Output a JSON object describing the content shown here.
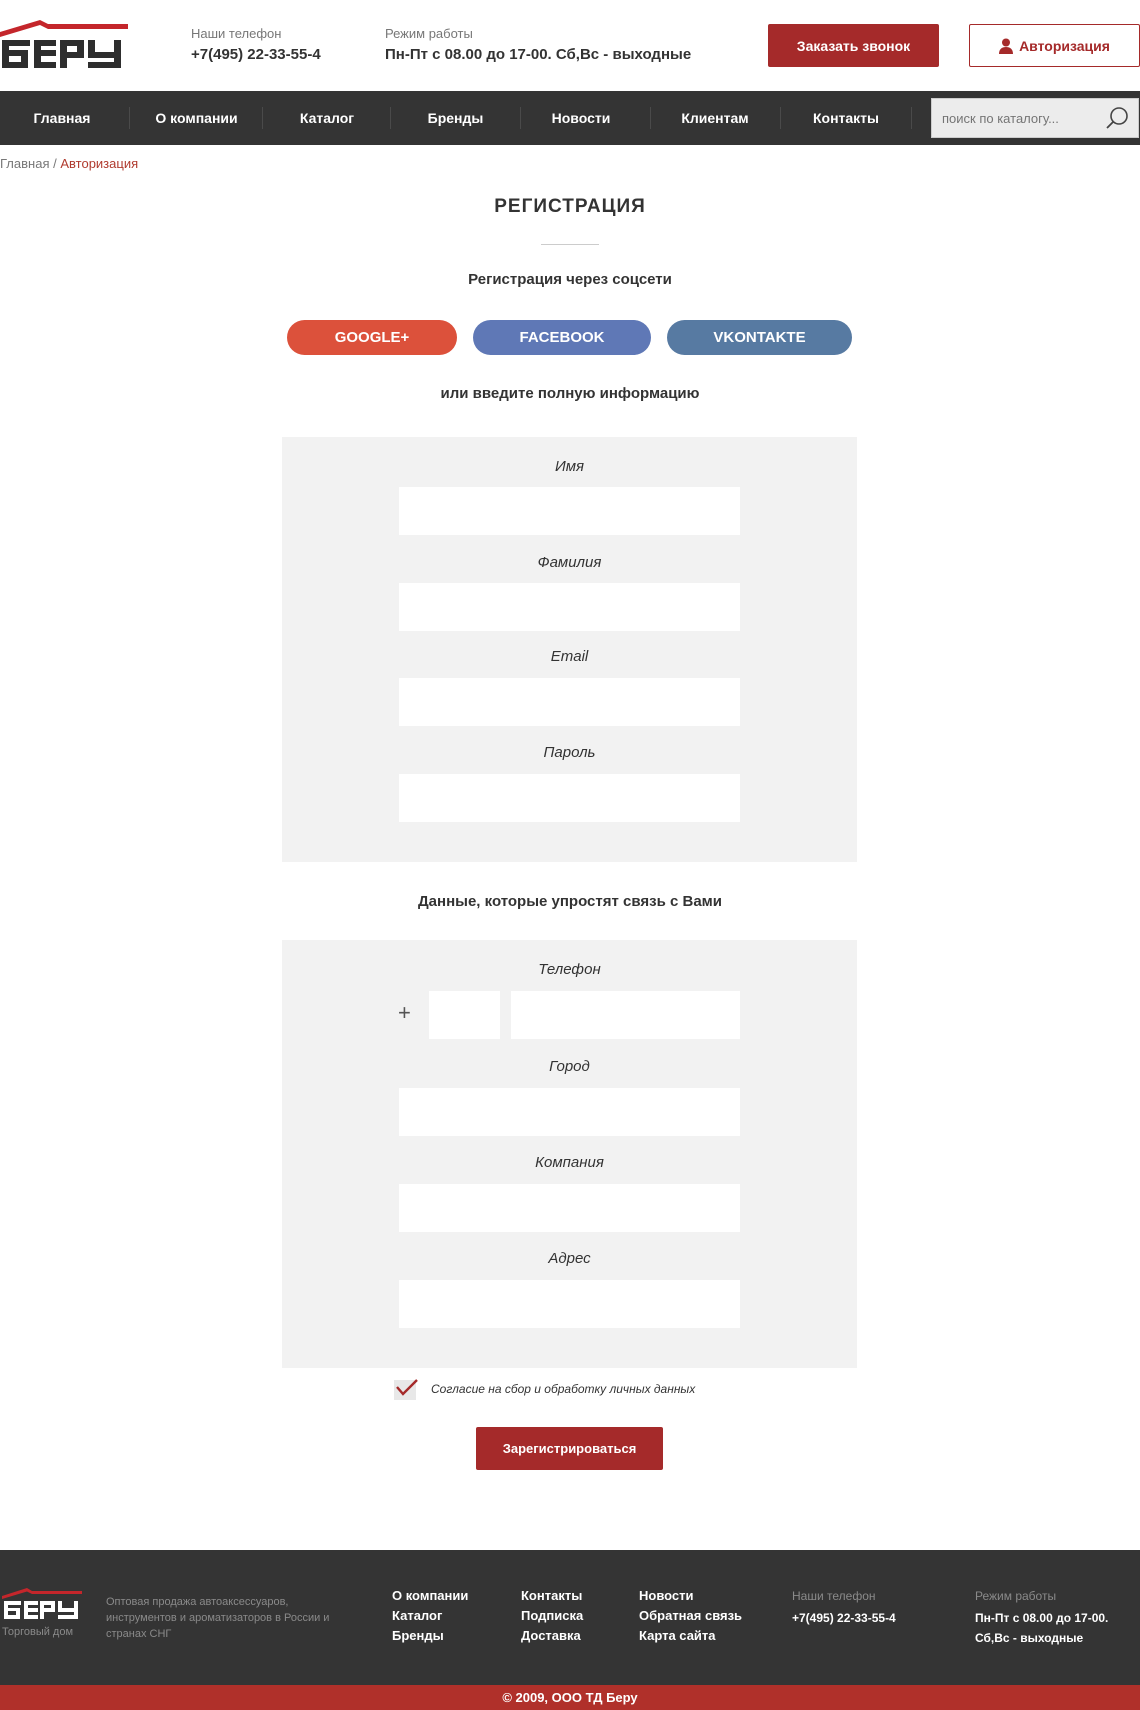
{
  "header": {
    "phone_label": "Наши телефон",
    "phone": "+7(495) 22-33-55-4",
    "hours_label": "Режим работы",
    "hours": "Пн-Пт с 08.00 до 17-00. Сб,Вс - выходные",
    "call_button": "Заказать звонок",
    "auth_button": "Авторизация",
    "logo_text": "БЕРУ"
  },
  "nav": {
    "items": [
      "Главная",
      "О компании",
      "Каталог",
      "Бренды",
      "Новости",
      "Клиентам",
      "Контакты"
    ],
    "search_placeholder": "поиск по каталогу..."
  },
  "breadcrumb": {
    "home": "Главная",
    "separator": "/",
    "current": "Авторизация"
  },
  "page": {
    "title": "РЕГИСТРАЦИЯ",
    "social_title": "Регистрация через соцсети",
    "social": {
      "google": "GOOGLE+",
      "facebook": "FACEBOOK",
      "vkontakte": "VKONTAKTE"
    },
    "or_text": "или введите полную информацию",
    "contact_title": "Данные, которые упростят связь с Вами"
  },
  "form": {
    "name_label": "Имя",
    "surname_label": "Фамилия",
    "email_label": "Email",
    "password_label": "Пароль",
    "phone_label": "Телефон",
    "phone_prefix": "+",
    "city_label": "Город",
    "company_label": "Компания",
    "address_label": "Адрес",
    "consent": "Согласие на сбор и обработку личных данных",
    "consent_checked": true,
    "submit": "Зарегистрироваться"
  },
  "footer": {
    "logo_text": "БЕРУ",
    "logo_sub": "Торговый дом",
    "description": "Оптовая продажа автоаксессуаров, инструментов и ароматизаторов в России и странах СНГ",
    "links_col1": [
      "О компании",
      "Каталог",
      "Бренды"
    ],
    "links_col2": [
      "Контакты",
      "Подписка",
      "Доставка"
    ],
    "links_col3": [
      "Новости",
      "Обратная связь",
      "Карта сайта"
    ],
    "phone_label": "Наши телефон",
    "phone": "+7(495) 22-33-55-4",
    "hours_label": "Режим работы",
    "hours_line1": "Пн-Пт с 08.00 до 17-00.",
    "hours_line2": "Сб,Вс - выходные",
    "copyright": "© 2009, ООО ТД Беру"
  },
  "colors": {
    "accent": "#a52a2a",
    "nav_bg": "#343434",
    "google": "#dc513b",
    "facebook": "#5f78b6",
    "vkontakte": "#577aa2",
    "panel_bg": "#f2f2f2"
  }
}
